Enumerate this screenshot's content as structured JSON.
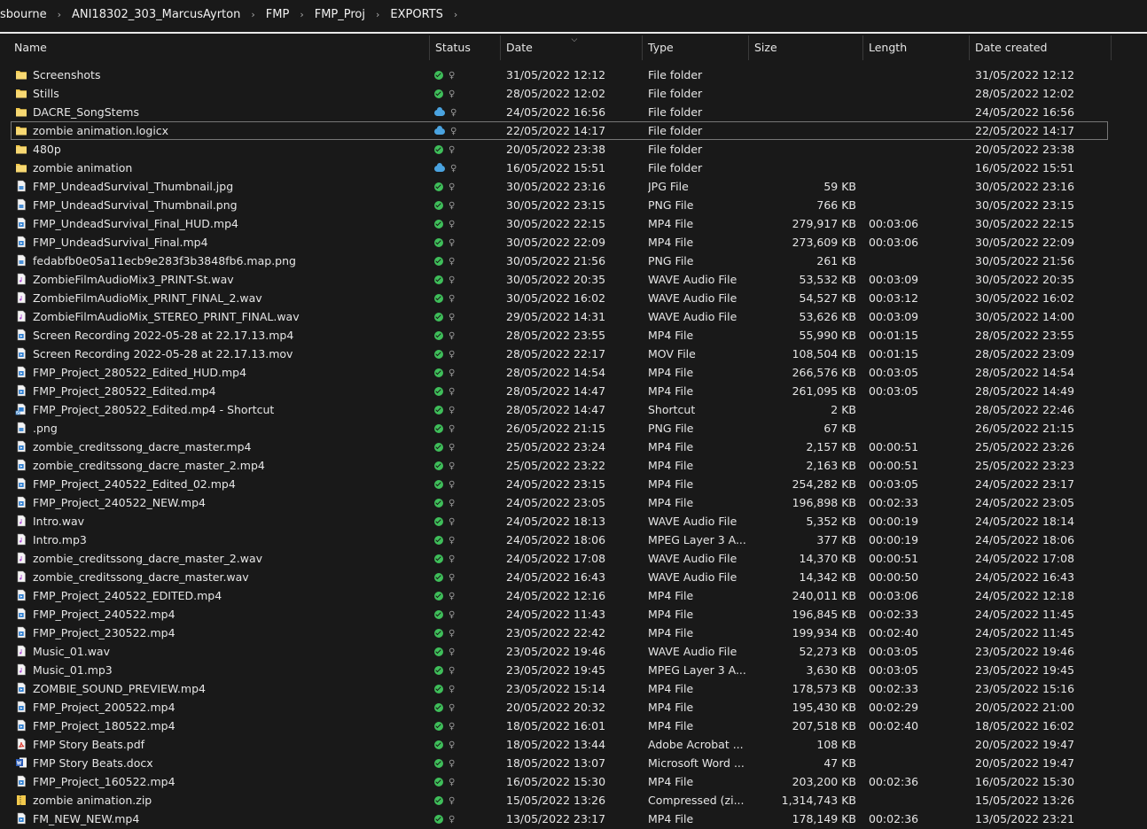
{
  "breadcrumb": [
    "sbourne",
    "ANI18302_303_MarcusAyrton",
    "FMP",
    "FMP_Proj",
    "EXPORTS"
  ],
  "columns": {
    "name": "Name",
    "status": "Status",
    "date": "Date",
    "type": "Type",
    "size": "Size",
    "length": "Length",
    "created": "Date created"
  },
  "colors": {
    "background": "#191919",
    "folder": "#f2c94c",
    "synced": "#3fbf5a",
    "cloud": "#4aa3e0"
  },
  "files": [
    {
      "name": "Screenshots",
      "icon": "folder-icon",
      "status": "synced",
      "date": "31/05/2022 12:12",
      "type": "File folder",
      "size": "",
      "length": "",
      "created": "31/05/2022 12:12"
    },
    {
      "name": "Stills",
      "icon": "folder-icon",
      "status": "synced",
      "date": "28/05/2022 12:02",
      "type": "File folder",
      "size": "",
      "length": "",
      "created": "28/05/2022 12:02"
    },
    {
      "name": "DACRE_SongStems",
      "icon": "folder-icon",
      "status": "cloud",
      "date": "24/05/2022 16:56",
      "type": "File folder",
      "size": "",
      "length": "",
      "created": "24/05/2022 16:56"
    },
    {
      "name": "zombie animation.logicx",
      "icon": "folder-icon",
      "status": "cloud",
      "date": "22/05/2022 14:17",
      "type": "File folder",
      "size": "",
      "length": "",
      "created": "22/05/2022 14:17",
      "selected": true
    },
    {
      "name": "480p",
      "icon": "folder-icon",
      "status": "synced",
      "date": "20/05/2022 23:38",
      "type": "File folder",
      "size": "",
      "length": "",
      "created": "20/05/2022 23:38"
    },
    {
      "name": "zombie animation",
      "icon": "folder-icon",
      "status": "cloud",
      "date": "16/05/2022 15:51",
      "type": "File folder",
      "size": "",
      "length": "",
      "created": "16/05/2022 15:51"
    },
    {
      "name": "FMP_UndeadSurvival_Thumbnail.jpg",
      "icon": "image-file-icon",
      "status": "synced",
      "date": "30/05/2022 23:16",
      "type": "JPG File",
      "size": "59 KB",
      "length": "",
      "created": "30/05/2022 23:16"
    },
    {
      "name": "FMP_UndeadSurvival_Thumbnail.png",
      "icon": "image-file-icon",
      "status": "synced",
      "date": "30/05/2022 23:15",
      "type": "PNG File",
      "size": "766 KB",
      "length": "",
      "created": "30/05/2022 23:15"
    },
    {
      "name": "FMP_UndeadSurvival_Final_HUD.mp4",
      "icon": "video-file-icon",
      "status": "synced",
      "date": "30/05/2022 22:15",
      "type": "MP4 File",
      "size": "279,917 KB",
      "length": "00:03:06",
      "created": "30/05/2022 22:15"
    },
    {
      "name": "FMP_UndeadSurvival_Final.mp4",
      "icon": "video-file-icon",
      "status": "synced",
      "date": "30/05/2022 22:09",
      "type": "MP4 File",
      "size": "273,609 KB",
      "length": "00:03:06",
      "created": "30/05/2022 22:09"
    },
    {
      "name": "fedabfb0e05a11ecb9e283f3b3848fb6.map.png",
      "icon": "image-file-icon",
      "status": "synced",
      "date": "30/05/2022 21:56",
      "type": "PNG File",
      "size": "261 KB",
      "length": "",
      "created": "30/05/2022 21:56"
    },
    {
      "name": "ZombieFilmAudioMix3_PRINT-St.wav",
      "icon": "audio-file-icon",
      "status": "synced",
      "date": "30/05/2022 20:35",
      "type": "WAVE Audio File",
      "size": "53,532 KB",
      "length": "00:03:09",
      "created": "30/05/2022 20:35"
    },
    {
      "name": "ZombieFilmAudioMix_PRINT_FINAL_2.wav",
      "icon": "audio-file-icon",
      "status": "synced",
      "date": "30/05/2022 16:02",
      "type": "WAVE Audio File",
      "size": "54,527 KB",
      "length": "00:03:12",
      "created": "30/05/2022 16:02"
    },
    {
      "name": "ZombieFilmAudioMix_STEREO_PRINT_FINAL.wav",
      "icon": "audio-file-icon",
      "status": "synced",
      "date": "29/05/2022 14:31",
      "type": "WAVE Audio File",
      "size": "53,626 KB",
      "length": "00:03:09",
      "created": "30/05/2022 14:00"
    },
    {
      "name": "Screen Recording 2022-05-28 at 22.17.13.mp4",
      "icon": "video-file-icon",
      "status": "synced",
      "date": "28/05/2022 23:55",
      "type": "MP4 File",
      "size": "55,990 KB",
      "length": "00:01:15",
      "created": "28/05/2022 23:55"
    },
    {
      "name": "Screen Recording 2022-05-28 at 22.17.13.mov",
      "icon": "video-file-icon",
      "status": "synced",
      "date": "28/05/2022 22:17",
      "type": "MOV File",
      "size": "108,504 KB",
      "length": "00:01:15",
      "created": "28/05/2022 23:09"
    },
    {
      "name": "FMP_Project_280522_Edited_HUD.mp4",
      "icon": "video-file-icon",
      "status": "synced",
      "date": "28/05/2022 14:54",
      "type": "MP4 File",
      "size": "266,576 KB",
      "length": "00:03:05",
      "created": "28/05/2022 14:54"
    },
    {
      "name": "FMP_Project_280522_Edited.mp4",
      "icon": "video-file-icon",
      "status": "synced",
      "date": "28/05/2022 14:47",
      "type": "MP4 File",
      "size": "261,095 KB",
      "length": "00:03:05",
      "created": "28/05/2022 14:49"
    },
    {
      "name": "FMP_Project_280522_Edited.mp4 - Shortcut",
      "icon": "shortcut-icon",
      "status": "synced",
      "date": "28/05/2022 14:47",
      "type": "Shortcut",
      "size": "2 KB",
      "length": "",
      "created": "28/05/2022 22:46"
    },
    {
      "name": ".png",
      "icon": "image-file-icon",
      "status": "synced",
      "date": "26/05/2022 21:15",
      "type": "PNG File",
      "size": "67 KB",
      "length": "",
      "created": "26/05/2022 21:15"
    },
    {
      "name": "zombie_creditssong_dacre_master.mp4",
      "icon": "video-file-icon",
      "status": "synced",
      "date": "25/05/2022 23:24",
      "type": "MP4 File",
      "size": "2,157 KB",
      "length": "00:00:51",
      "created": "25/05/2022 23:26"
    },
    {
      "name": "zombie_creditssong_dacre_master_2.mp4",
      "icon": "video-file-icon",
      "status": "synced",
      "date": "25/05/2022 23:22",
      "type": "MP4 File",
      "size": "2,163 KB",
      "length": "00:00:51",
      "created": "25/05/2022 23:23"
    },
    {
      "name": "FMP_Project_240522_Edited_02.mp4",
      "icon": "video-file-icon",
      "status": "synced",
      "date": "24/05/2022 23:15",
      "type": "MP4 File",
      "size": "254,282 KB",
      "length": "00:03:05",
      "created": "24/05/2022 23:17"
    },
    {
      "name": "FMP_Project_240522_NEW.mp4",
      "icon": "video-file-icon",
      "status": "synced",
      "date": "24/05/2022 23:05",
      "type": "MP4 File",
      "size": "196,898 KB",
      "length": "00:02:33",
      "created": "24/05/2022 23:05"
    },
    {
      "name": "Intro.wav",
      "icon": "audio-file-icon",
      "status": "synced",
      "date": "24/05/2022 18:13",
      "type": "WAVE Audio File",
      "size": "5,352 KB",
      "length": "00:00:19",
      "created": "24/05/2022 18:14"
    },
    {
      "name": "Intro.mp3",
      "icon": "audio-file-icon",
      "status": "synced",
      "date": "24/05/2022 18:06",
      "type": "MPEG Layer 3 A...",
      "size": "377 KB",
      "length": "00:00:19",
      "created": "24/05/2022 18:06"
    },
    {
      "name": "zombie_creditssong_dacre_master_2.wav",
      "icon": "audio-file-icon",
      "status": "synced",
      "date": "24/05/2022 17:08",
      "type": "WAVE Audio File",
      "size": "14,370 KB",
      "length": "00:00:51",
      "created": "24/05/2022 17:08"
    },
    {
      "name": "zombie_creditssong_dacre_master.wav",
      "icon": "audio-file-icon",
      "status": "synced",
      "date": "24/05/2022 16:43",
      "type": "WAVE Audio File",
      "size": "14,342 KB",
      "length": "00:00:50",
      "created": "24/05/2022 16:43"
    },
    {
      "name": "FMP_Project_240522_EDITED.mp4",
      "icon": "video-file-icon",
      "status": "synced",
      "date": "24/05/2022 12:16",
      "type": "MP4 File",
      "size": "240,011 KB",
      "length": "00:03:06",
      "created": "24/05/2022 12:18"
    },
    {
      "name": "FMP_Project_240522.mp4",
      "icon": "video-file-icon",
      "status": "synced",
      "date": "24/05/2022 11:43",
      "type": "MP4 File",
      "size": "196,845 KB",
      "length": "00:02:33",
      "created": "24/05/2022 11:45"
    },
    {
      "name": "FMP_Project_230522.mp4",
      "icon": "video-file-icon",
      "status": "synced",
      "date": "23/05/2022 22:42",
      "type": "MP4 File",
      "size": "199,934 KB",
      "length": "00:02:40",
      "created": "24/05/2022 11:45"
    },
    {
      "name": "Music_01.wav",
      "icon": "audio-file-icon",
      "status": "synced",
      "date": "23/05/2022 19:46",
      "type": "WAVE Audio File",
      "size": "52,273 KB",
      "length": "00:03:05",
      "created": "23/05/2022 19:46"
    },
    {
      "name": "Music_01.mp3",
      "icon": "audio-file-icon",
      "status": "synced",
      "date": "23/05/2022 19:45",
      "type": "MPEG Layer 3 A...",
      "size": "3,630 KB",
      "length": "00:03:05",
      "created": "23/05/2022 19:45"
    },
    {
      "name": "ZOMBIE_SOUND_PREVIEW.mp4",
      "icon": "video-file-icon",
      "status": "synced",
      "date": "23/05/2022 15:14",
      "type": "MP4 File",
      "size": "178,573 KB",
      "length": "00:02:33",
      "created": "23/05/2022 15:16"
    },
    {
      "name": "FMP_Project_200522.mp4",
      "icon": "video-file-icon",
      "status": "synced",
      "date": "20/05/2022 20:32",
      "type": "MP4 File",
      "size": "195,430 KB",
      "length": "00:02:29",
      "created": "20/05/2022 21:00"
    },
    {
      "name": "FMP_Project_180522.mp4",
      "icon": "video-file-icon",
      "status": "synced",
      "date": "18/05/2022 16:01",
      "type": "MP4 File",
      "size": "207,518 KB",
      "length": "00:02:40",
      "created": "18/05/2022 16:02"
    },
    {
      "name": "FMP Story Beats.pdf",
      "icon": "pdf-file-icon",
      "status": "synced",
      "date": "18/05/2022 13:44",
      "type": "Adobe Acrobat ...",
      "size": "108 KB",
      "length": "",
      "created": "20/05/2022 19:47"
    },
    {
      "name": "FMP Story Beats.docx",
      "icon": "word-file-icon",
      "status": "synced",
      "date": "18/05/2022 13:07",
      "type": "Microsoft Word ...",
      "size": "47 KB",
      "length": "",
      "created": "20/05/2022 19:47"
    },
    {
      "name": "FMP_Project_160522.mp4",
      "icon": "video-file-icon",
      "status": "synced",
      "date": "16/05/2022 15:30",
      "type": "MP4 File",
      "size": "203,200 KB",
      "length": "00:02:36",
      "created": "16/05/2022 15:30"
    },
    {
      "name": "zombie animation.zip",
      "icon": "zip-file-icon",
      "status": "synced",
      "date": "15/05/2022 13:26",
      "type": "Compressed (zi...",
      "size": "1,314,743 KB",
      "length": "",
      "created": "15/05/2022 13:26"
    },
    {
      "name": "FM_NEW_NEW.mp4",
      "icon": "video-file-icon",
      "status": "synced",
      "date": "13/05/2022 23:17",
      "type": "MP4 File",
      "size": "178,149 KB",
      "length": "00:02:36",
      "created": "13/05/2022 23:21"
    }
  ]
}
